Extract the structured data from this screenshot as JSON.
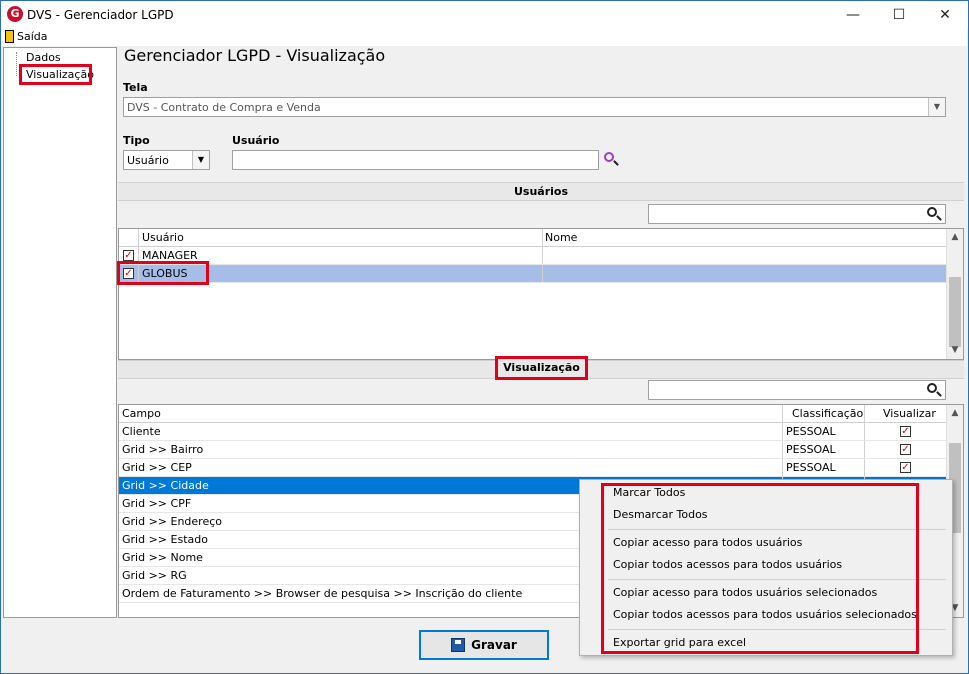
{
  "window": {
    "title": "DVS - Gerenciador LGPD",
    "app_icon": "G",
    "minimize": "—",
    "maximize": "☐",
    "close": "✕"
  },
  "menu": {
    "exit_label": "Saída"
  },
  "tree": {
    "items": [
      {
        "label": "Dados"
      },
      {
        "label": "Visualização"
      }
    ]
  },
  "page": {
    "title": "Gerenciador LGPD - Visualização"
  },
  "tela": {
    "label": "Tela",
    "value": "DVS - Contrato de Compra e Venda"
  },
  "tipo": {
    "label": "Tipo",
    "value": "Usuário"
  },
  "usuario": {
    "label": "Usuário",
    "value": ""
  },
  "users_section": {
    "title": "Usuários",
    "columns": [
      "Usuário",
      "Nome"
    ],
    "rows": [
      {
        "checked": true,
        "user": "MANAGER",
        "name": ""
      },
      {
        "checked": true,
        "user": "GLOBUS",
        "name": ""
      }
    ]
  },
  "view_section": {
    "title": "Visualização",
    "columns": [
      "Campo",
      "Classificação",
      "Visualizar"
    ],
    "rows": [
      {
        "field": "Cliente",
        "class": "PESSOAL",
        "visible": true
      },
      {
        "field": "Grid >> Bairro",
        "class": "PESSOAL",
        "visible": true
      },
      {
        "field": "Grid >> CEP",
        "class": "PESSOAL",
        "visible": true
      },
      {
        "field": "Grid >> Cidade",
        "class": "",
        "visible": false
      },
      {
        "field": "Grid >> CPF",
        "class": "",
        "visible": false
      },
      {
        "field": "Grid >> Endereço",
        "class": "",
        "visible": false
      },
      {
        "field": "Grid >> Estado",
        "class": "",
        "visible": false
      },
      {
        "field": "Grid >> Nome",
        "class": "",
        "visible": false
      },
      {
        "field": "Grid >> RG",
        "class": "",
        "visible": false
      },
      {
        "field": "Ordem de Faturamento >> Browser de pesquisa >> Inscrição do cliente",
        "class": "",
        "visible": false
      }
    ]
  },
  "context_menu": {
    "items": [
      "Marcar Todos",
      "Desmarcar Todos",
      "Copiar acesso para todos usuários",
      "Copiar todos acessos para todos usuários",
      "Copiar acesso para todos usuários selecionados",
      "Copiar todos acessos para todos usuários selecionados",
      "Exportar grid para excel"
    ]
  },
  "save_button": {
    "label": "Gravar"
  },
  "colors": {
    "highlight_red": "#e0001a",
    "row_selected": "#a6bde8",
    "row_focus": "#0078d7"
  }
}
